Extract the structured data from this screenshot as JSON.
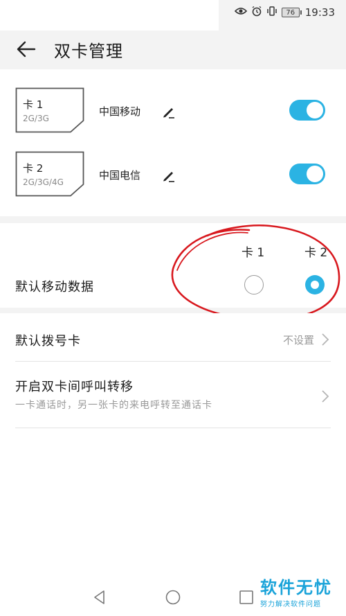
{
  "status_bar": {
    "battery": "76",
    "time": "19:33"
  },
  "header": {
    "title": "双卡管理"
  },
  "sims": [
    {
      "name": "卡 1",
      "network": "2G/3G",
      "carrier": "中国移动",
      "enabled": true
    },
    {
      "name": "卡 2",
      "network": "2G/3G/4G",
      "carrier": "中国电信",
      "enabled": true
    }
  ],
  "default_data": {
    "label": "默认移动数据",
    "col1": "卡 1",
    "col2": "卡 2",
    "selected": "卡 2"
  },
  "list": {
    "default_dial_label": "默认拨号卡",
    "default_dial_value": "不设置",
    "call_forward_label": "开启双卡间呼叫转移",
    "call_forward_desc": "一卡通话时，另一张卡的来电呼转至通话卡"
  },
  "watermark": {
    "title": "软件无忧",
    "subtitle": "努力解决软件问题"
  },
  "colors": {
    "accent": "#2bb3e3",
    "annotation": "#d8181e"
  }
}
